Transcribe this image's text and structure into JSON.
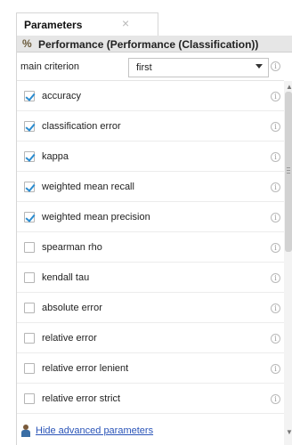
{
  "tab": {
    "label": "Parameters",
    "close_symbol": "×"
  },
  "operator": {
    "icon": "percent-icon",
    "icon_symbol": "%",
    "title": "Performance (Performance (Classification))"
  },
  "main_criterion": {
    "label": "main criterion",
    "value": "first"
  },
  "parameters": [
    {
      "label": "accuracy",
      "checked": true
    },
    {
      "label": "classification error",
      "checked": true
    },
    {
      "label": "kappa",
      "checked": true
    },
    {
      "label": "weighted mean recall",
      "checked": true
    },
    {
      "label": "weighted mean precision",
      "checked": true
    },
    {
      "label": "spearman rho",
      "checked": false
    },
    {
      "label": "kendall tau",
      "checked": false
    },
    {
      "label": "absolute error",
      "checked": false
    },
    {
      "label": "relative error",
      "checked": false
    },
    {
      "label": "relative error lenient",
      "checked": false
    },
    {
      "label": "relative error strict",
      "checked": false
    }
  ],
  "info_symbol": "i",
  "footer": {
    "icon": "user-icon",
    "link": "Hide advanced parameters"
  },
  "colors": {
    "check": "#2a8cd0",
    "link": "#2a54b8",
    "header_bg": "#e6e6e6"
  }
}
